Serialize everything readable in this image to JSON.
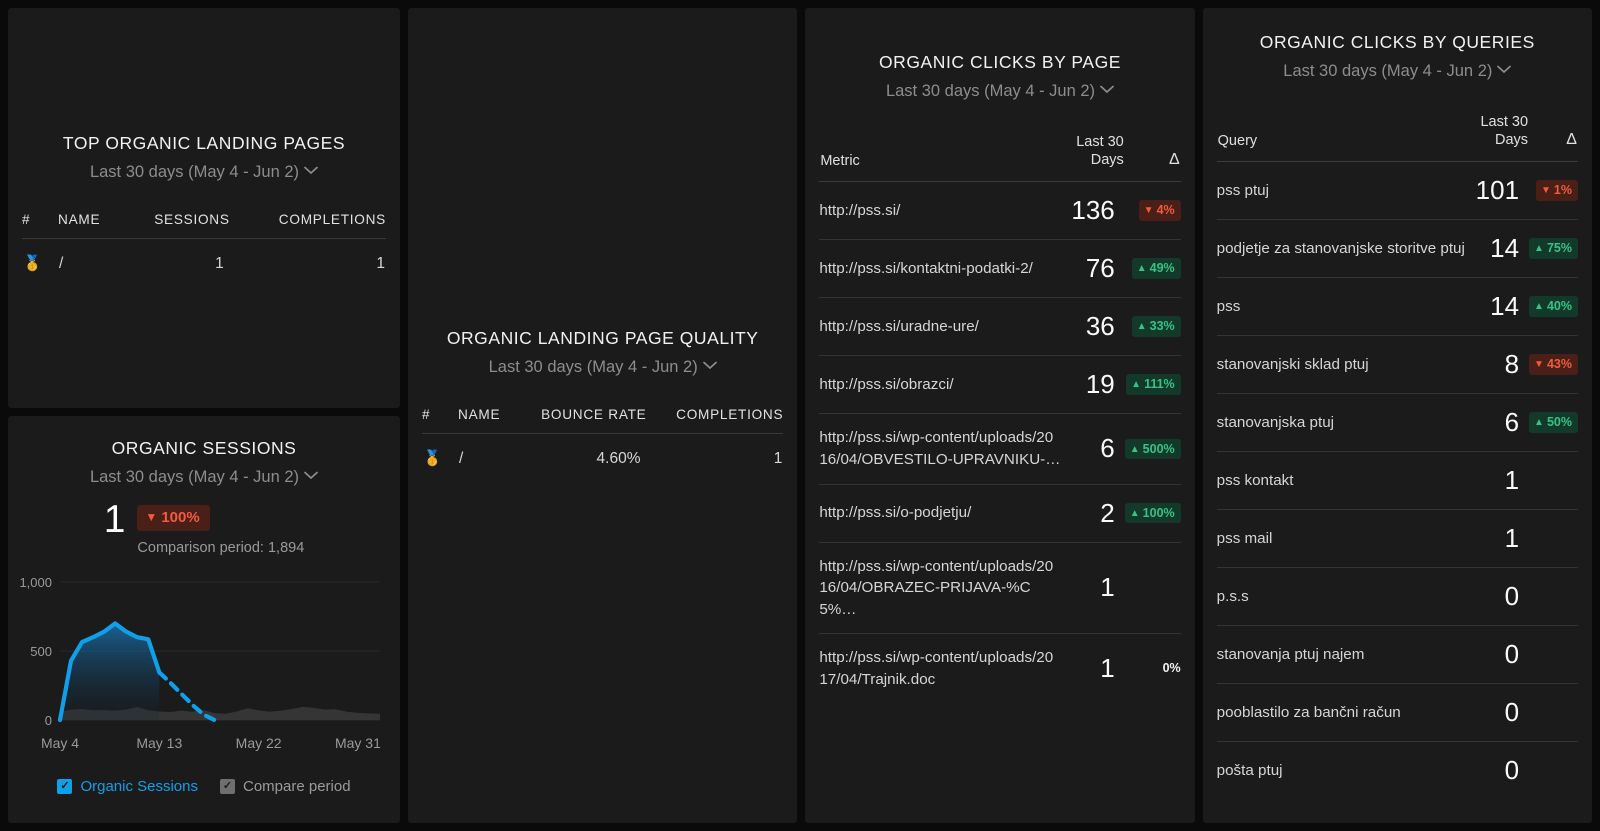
{
  "theme": {
    "bg": "#0a0a0a",
    "card_bg": "#1b1b1b",
    "accent_blue": "#0fa0ea",
    "up_green": "#36c486",
    "down_red": "#f05c3c",
    "up_bg": "#13392a",
    "down_bg": "#4a1f18"
  },
  "top_landing_pages": {
    "title": "TOP ORGANIC LANDING PAGES",
    "date_range": "Last 30 days (May 4 - Jun 2)",
    "columns": [
      "#",
      "NAME",
      "SESSIONS",
      "COMPLETIONS"
    ],
    "rows": [
      {
        "rank_icon": "medal-icon",
        "rank": "🥇",
        "name": "/",
        "sessions": "1",
        "completions": "1"
      }
    ]
  },
  "organic_sessions": {
    "title": "ORGANIC SESSIONS",
    "date_range": "Last 30 days (May 4 - Jun 2)",
    "value": "1",
    "delta": "100%",
    "delta_direction": "down",
    "delta_arrow": "▼",
    "comparison": "Comparison period: 1,894",
    "legend": [
      {
        "label": "Organic Sessions",
        "color": "#0fa0ea",
        "checked": true
      },
      {
        "label": "Compare period",
        "color": "#6f6f6f",
        "checked": true
      }
    ]
  },
  "chart_data": {
    "type": "area",
    "title": "ORGANIC SESSIONS",
    "xlabel": "",
    "ylabel": "",
    "ylim": [
      0,
      1000
    ],
    "yticks": [
      0,
      500,
      1000
    ],
    "ytick_labels": [
      "0",
      "500",
      "1,000"
    ],
    "xtick_labels": [
      "May 4",
      "May 13",
      "May 22",
      "May 31"
    ],
    "grid": false,
    "legend_position": "bottom",
    "series": [
      {
        "name": "Organic Sessions",
        "color": "#0fa0ea",
        "style": "solid-then-dashed",
        "dash_starts_at_index": 9,
        "x": [
          "May 4",
          "May 5",
          "May 6",
          "May 7",
          "May 8",
          "May 9",
          "May 10",
          "May 11",
          "May 12",
          "May 13",
          "May 14",
          "May 15",
          "May 16",
          "May 17",
          "May 18",
          "May 19",
          "May 20",
          "May 21",
          "May 22",
          "May 23",
          "May 24",
          "May 25",
          "May 26",
          "May 27",
          "May 28",
          "May 29",
          "May 30",
          "May 31",
          "Jun 1",
          "Jun 2"
        ],
        "values": [
          0,
          430,
          565,
          600,
          640,
          700,
          640,
          600,
          585,
          345,
          270,
          190,
          110,
          40,
          0,
          null,
          null,
          null,
          null,
          null,
          null,
          null,
          null,
          null,
          null,
          null,
          null,
          null,
          null,
          null
        ]
      },
      {
        "name": "Compare period",
        "color": "#6f6f6f",
        "style": "area",
        "values": [
          60,
          75,
          80,
          70,
          72,
          68,
          75,
          95,
          70,
          62,
          58,
          68,
          60,
          72,
          50,
          45,
          62,
          85,
          70,
          60,
          68,
          80,
          95,
          88,
          75,
          78,
          60,
          52,
          48,
          45
        ]
      }
    ]
  },
  "landing_page_quality": {
    "title": "ORGANIC LANDING PAGE QUALITY",
    "date_range": "Last 30 days (May 4 - Jun 2)",
    "columns": [
      "#",
      "NAME",
      "BOUNCE RATE",
      "COMPLETIONS"
    ],
    "rows": [
      {
        "rank_icon": "medal-icon",
        "rank": "🥇",
        "name": "/",
        "bounce_rate": "4.60%",
        "completions": "1"
      }
    ]
  },
  "clicks_by_page": {
    "title": "ORGANIC CLICKS BY PAGE",
    "date_range": "Last 30 days (May 4 - Jun 2)",
    "columns": {
      "label": "Metric",
      "value": "Last 30\nDays",
      "value_line1": "Last 30",
      "value_line2": "Days",
      "delta": "Δ"
    },
    "rows": [
      {
        "label": "http://pss.si/",
        "value": "136",
        "delta": "4%",
        "direction": "down",
        "arrow": "▼"
      },
      {
        "label": "http://pss.si/kontaktni-podatki-2/",
        "value": "76",
        "delta": "49%",
        "direction": "up",
        "arrow": "▲"
      },
      {
        "label": "http://pss.si/uradne-ure/",
        "value": "36",
        "delta": "33%",
        "direction": "up",
        "arrow": "▲"
      },
      {
        "label": "http://pss.si/obrazci/",
        "value": "19",
        "delta": "111%",
        "direction": "up",
        "arrow": "▲"
      },
      {
        "label": "http://pss.si/wp-content/uploads/2016/04/OBVESTILO-UPRAVNIKU-…",
        "value": "6",
        "delta": "500%",
        "direction": "up",
        "arrow": "▲"
      },
      {
        "label": "http://pss.si/o-podjetju/",
        "value": "2",
        "delta": "100%",
        "direction": "up",
        "arrow": "▲"
      },
      {
        "label": "http://pss.si/wp-content/uploads/2016/04/OBRAZEC-PRIJAVA-%C5%…",
        "value": "1",
        "delta": "",
        "direction": "none",
        "arrow": ""
      },
      {
        "label": "http://pss.si/wp-content/uploads/2017/04/Trajnik.doc",
        "value": "1",
        "delta": "0%",
        "direction": "flat",
        "arrow": ""
      }
    ]
  },
  "clicks_by_queries": {
    "title": "ORGANIC CLICKS BY QUERIES",
    "date_range": "Last 30 days (May 4 - Jun 2)",
    "columns": {
      "label": "Query",
      "value_line1": "Last 30",
      "value_line2": "Days",
      "delta": "Δ"
    },
    "rows": [
      {
        "label": "pss ptuj",
        "value": "101",
        "delta": "1%",
        "direction": "down",
        "arrow": "▼"
      },
      {
        "label": "podjetje za stanovanjske storitve ptuj",
        "value": "14",
        "delta": "75%",
        "direction": "up",
        "arrow": "▲"
      },
      {
        "label": "pss",
        "value": "14",
        "delta": "40%",
        "direction": "up",
        "arrow": "▲"
      },
      {
        "label": "stanovanjski sklad ptuj",
        "value": "8",
        "delta": "43%",
        "direction": "down",
        "arrow": "▼"
      },
      {
        "label": "stanovanjska ptuj",
        "value": "6",
        "delta": "50%",
        "direction": "up",
        "arrow": "▲"
      },
      {
        "label": "pss kontakt",
        "value": "1",
        "delta": "",
        "direction": "none",
        "arrow": ""
      },
      {
        "label": "pss mail",
        "value": "1",
        "delta": "",
        "direction": "none",
        "arrow": ""
      },
      {
        "label": "p.s.s",
        "value": "0",
        "delta": "",
        "direction": "none",
        "arrow": ""
      },
      {
        "label": "stanovanja ptuj najem",
        "value": "0",
        "delta": "",
        "direction": "none",
        "arrow": ""
      },
      {
        "label": "pooblastilo za bančni račun",
        "value": "0",
        "delta": "",
        "direction": "none",
        "arrow": ""
      },
      {
        "label": "pošta ptuj",
        "value": "0",
        "delta": "",
        "direction": "none",
        "arrow": ""
      }
    ]
  }
}
